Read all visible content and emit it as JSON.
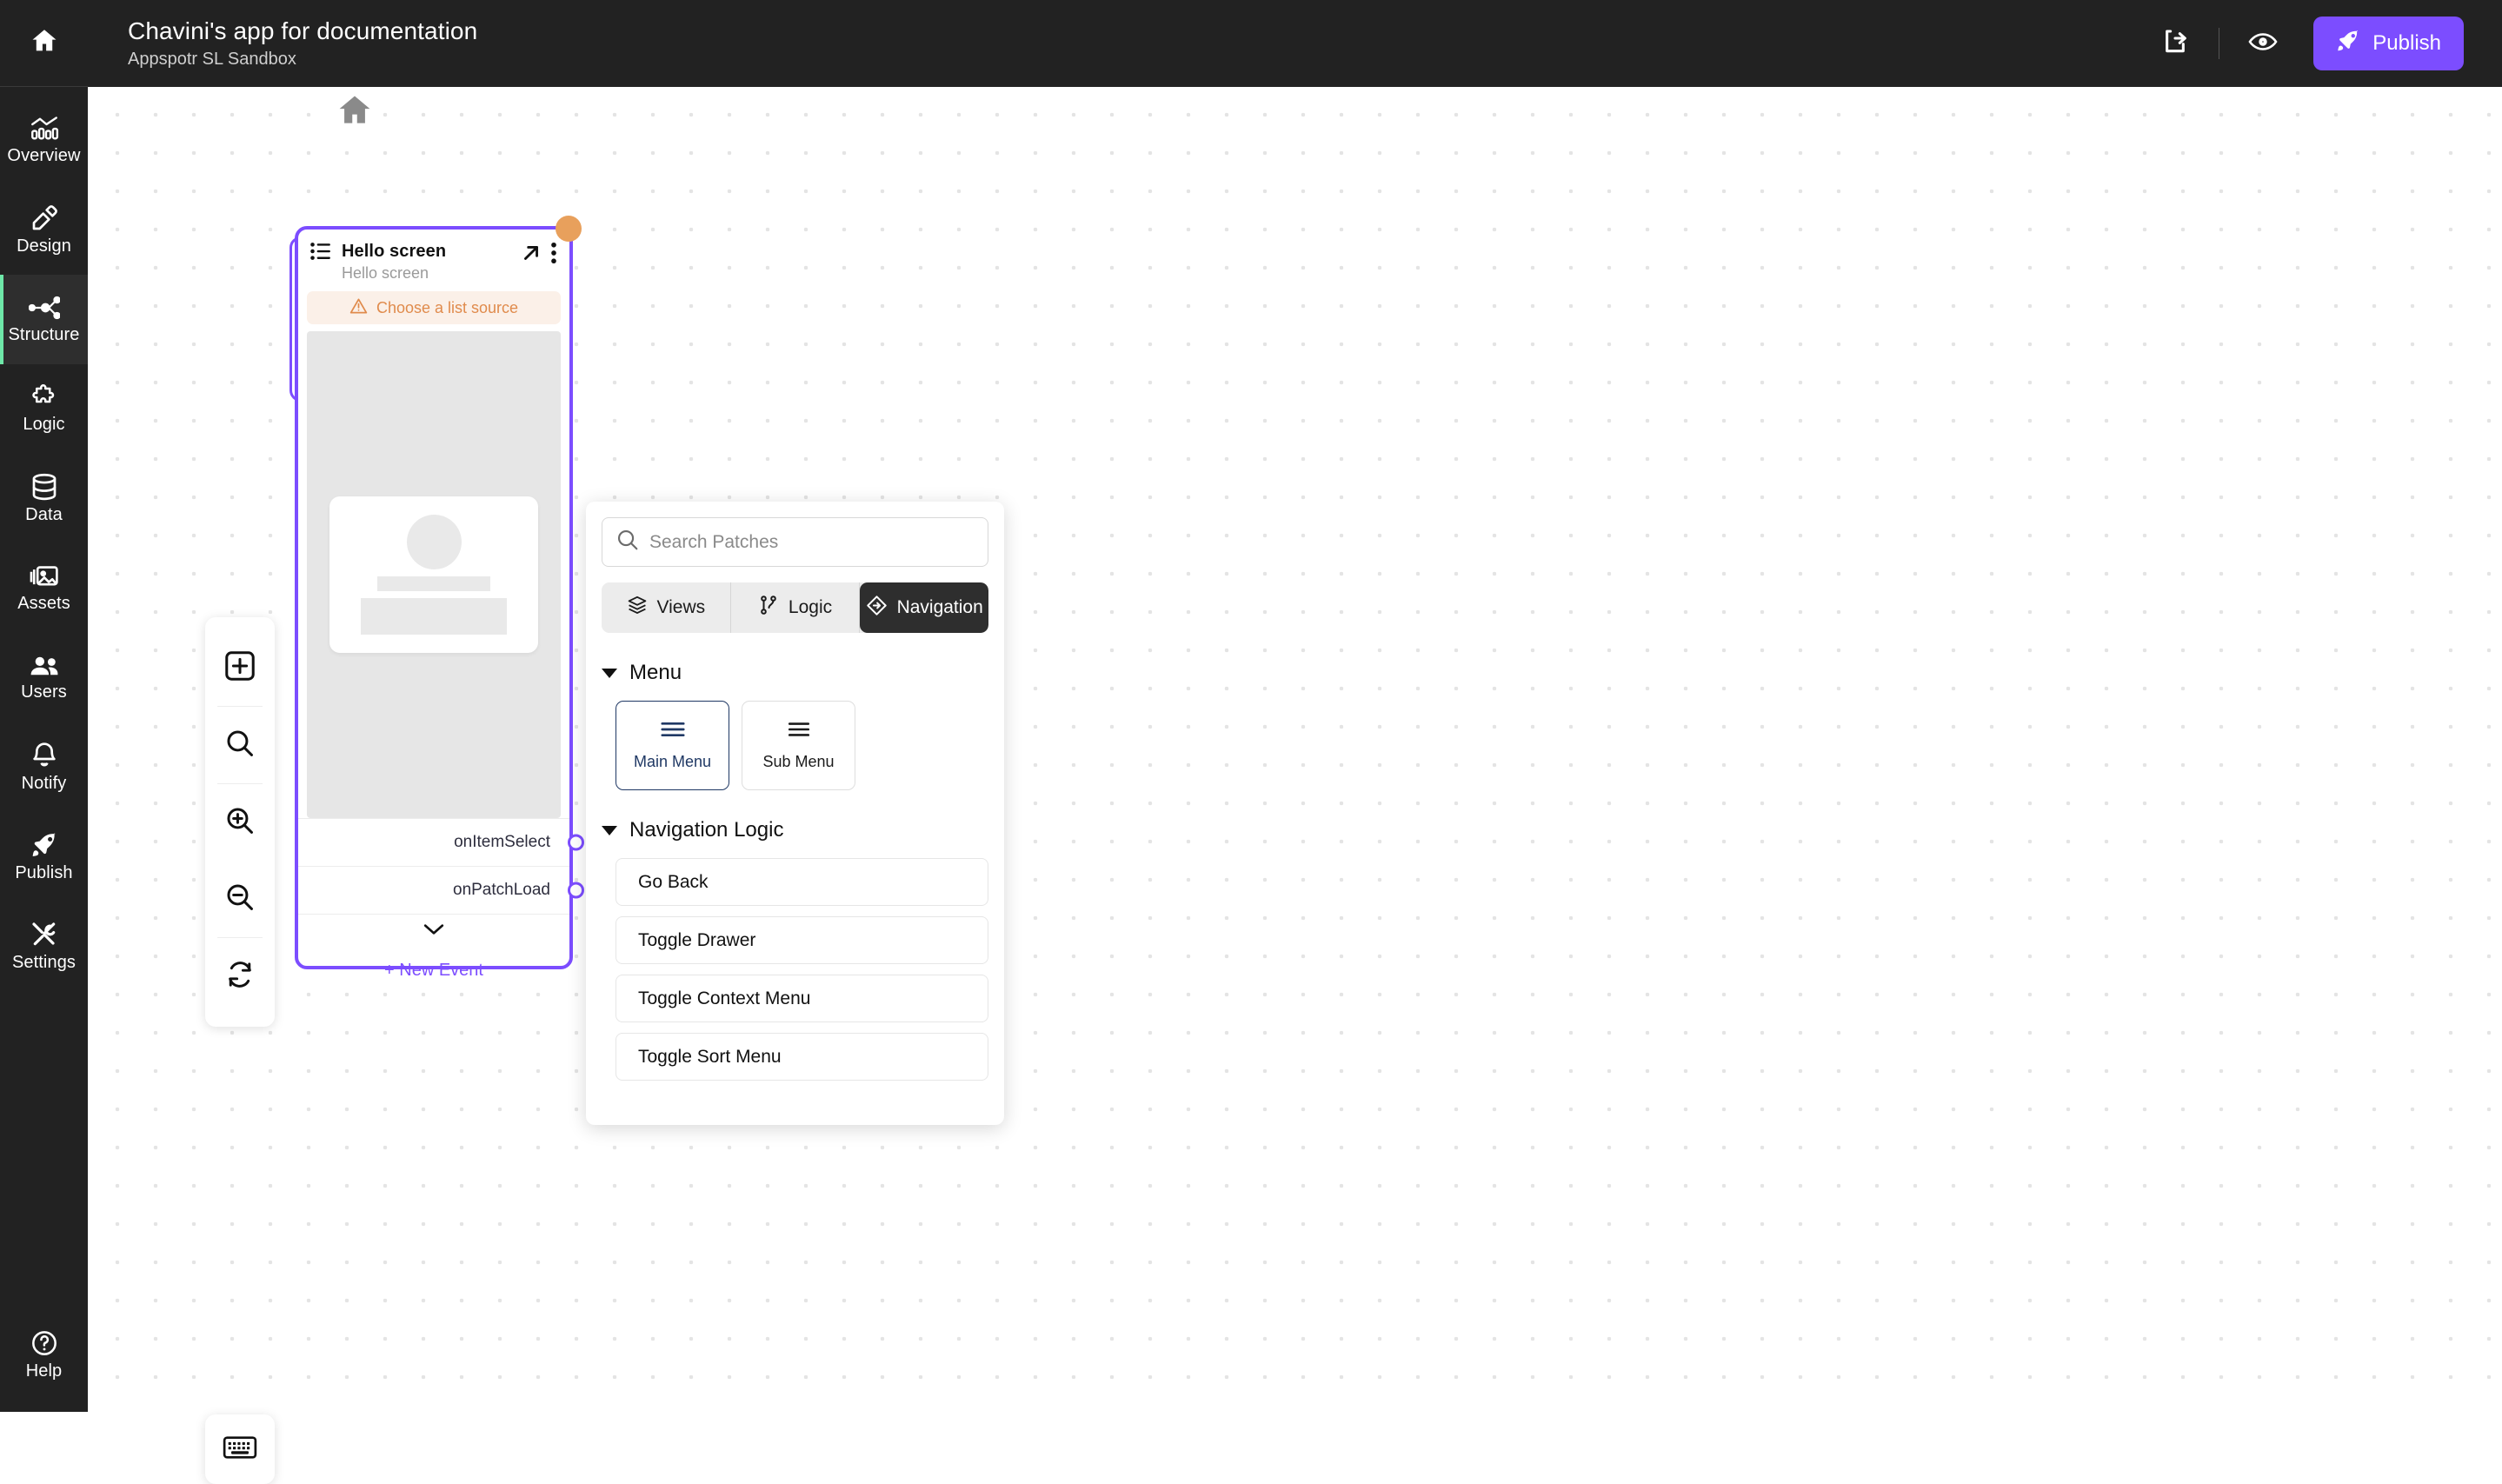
{
  "header": {
    "title": "Chavini's app for documentation",
    "subtitle": "Appspotr SL Sandbox",
    "home_icon": "home-icon",
    "share_icon": "share-icon",
    "preview_icon": "eye-icon",
    "publish_label": "Publish",
    "publish_icon": "rocket-icon",
    "publish_color": "#7c4dff"
  },
  "sidebar": {
    "items": [
      {
        "label": "Overview",
        "icon": "chart-bars-icon",
        "active": false
      },
      {
        "label": "Design",
        "icon": "pencil-ruler-icon",
        "active": false
      },
      {
        "label": "Structure",
        "icon": "nodes-graph-icon",
        "active": true
      },
      {
        "label": "Logic",
        "icon": "puzzle-piece-icon",
        "active": false
      },
      {
        "label": "Data",
        "icon": "database-icon",
        "active": false
      },
      {
        "label": "Assets",
        "icon": "image-stack-icon",
        "active": false
      },
      {
        "label": "Users",
        "icon": "users-icon",
        "active": false
      },
      {
        "label": "Notify",
        "icon": "bell-icon",
        "active": false
      },
      {
        "label": "Publish",
        "icon": "rocket-icon",
        "active": false
      },
      {
        "label": "Settings",
        "icon": "tools-icon",
        "active": false
      }
    ],
    "help": {
      "label": "Help",
      "icon": "question-circle-icon"
    },
    "active_accent": "#6ee7a8"
  },
  "canvas": {
    "keyboard_button_icon": "keyboard-icon",
    "toolbar": [
      {
        "icon": "add-node-icon",
        "name": "add-node-button"
      },
      {
        "icon": "search-icon",
        "name": "search-canvas-button"
      },
      {
        "icon": "zoom-in-icon",
        "name": "zoom-in-button"
      },
      {
        "icon": "zoom-out-icon",
        "name": "zoom-out-button"
      },
      {
        "icon": "refresh-icon",
        "name": "reset-view-button"
      }
    ],
    "start_marker_icon": "home-icon",
    "node": {
      "title": "Hello screen",
      "subtitle": "Hello screen",
      "type_icon": "list-icon",
      "open_icon": "arrow-up-right-icon",
      "menu_icon": "kebab-menu-icon",
      "warning": {
        "text": "Choose a list source",
        "icon": "warning-triangle-icon",
        "color": "#e08b4c",
        "background": "#fbf0e8"
      },
      "events": [
        {
          "label": "onItemSelect"
        },
        {
          "label": "onPatchLoad"
        }
      ],
      "expand_icon": "chevron-down-icon",
      "new_event_label": "+ New Event",
      "accent_color": "#7c4dff",
      "badge_color": "#e8a05c"
    }
  },
  "patch_panel": {
    "search": {
      "placeholder": "Search Patches",
      "value": "",
      "icon": "search-icon"
    },
    "tabs": [
      {
        "label": "Views",
        "icon": "layers-icon",
        "active": false
      },
      {
        "label": "Logic",
        "icon": "git-branch-icon",
        "active": false
      },
      {
        "label": "Navigation",
        "icon": "diamond-arrow-icon",
        "active": true
      }
    ],
    "sections": [
      {
        "title": "Menu",
        "expanded": true,
        "tiles": [
          {
            "label": "Main Menu",
            "icon": "menu-lines-icon",
            "selected": true
          },
          {
            "label": "Sub Menu",
            "icon": "menu-lines-icon",
            "selected": false
          }
        ]
      },
      {
        "title": "Navigation Logic",
        "expanded": true,
        "items": [
          {
            "label": "Go Back"
          },
          {
            "label": "Toggle Drawer"
          },
          {
            "label": "Toggle Context Menu"
          },
          {
            "label": "Toggle Sort Menu"
          }
        ]
      }
    ]
  }
}
